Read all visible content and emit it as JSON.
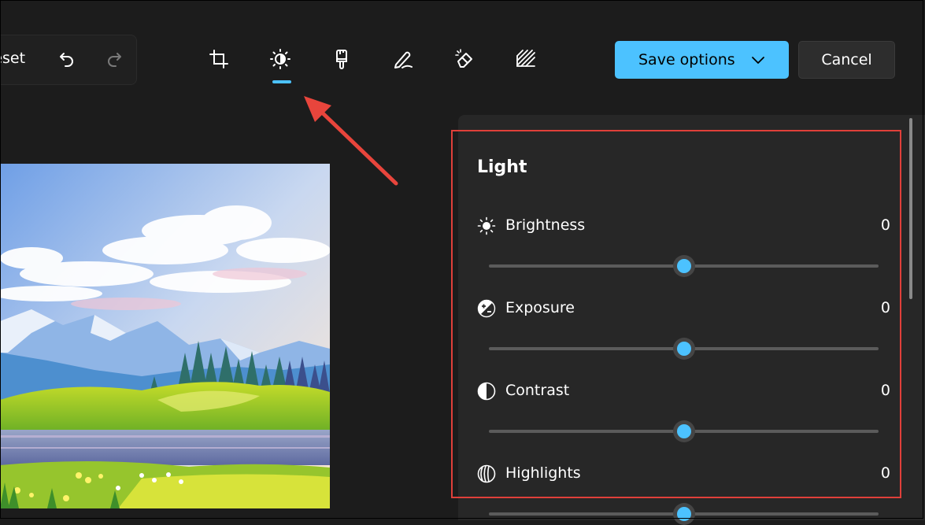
{
  "toolbar": {
    "reset_label": "Reset",
    "save_label": "Save options",
    "cancel_label": "Cancel",
    "active_tool": "adjustment",
    "tools": [
      "crop-icon",
      "adjustment-icon",
      "filter-icon",
      "markup-icon",
      "erase-icon",
      "background-blur-icon"
    ]
  },
  "panel": {
    "title": "Light",
    "adjustments": [
      {
        "label": "Brightness",
        "value": "0",
        "icon": "brightness-icon",
        "slider": 0.5
      },
      {
        "label": "Exposure",
        "value": "0",
        "icon": "exposure-icon",
        "slider": 0.5
      },
      {
        "label": "Contrast",
        "value": "0",
        "icon": "contrast-icon",
        "slider": 0.5
      },
      {
        "label": "Highlights",
        "value": "0",
        "icon": "highlights-icon",
        "slider": 0.5
      }
    ]
  },
  "colors": {
    "accent": "#4cc2ff",
    "annotation": "#e0403a",
    "background": "#1c1c1c",
    "panel": "#272727"
  }
}
